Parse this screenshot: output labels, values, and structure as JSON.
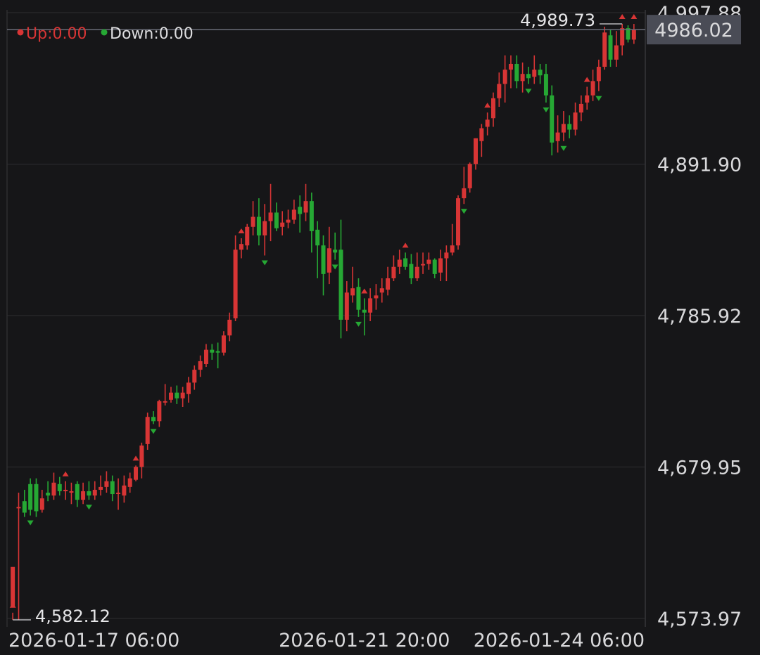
{
  "legend": {
    "up_label": "Up:0.00",
    "down_label": "Down:0.00",
    "up_color": "#d83535",
    "down_color": "#26a834"
  },
  "colors": {
    "background": "#161618",
    "grid": "#2e2e31",
    "axis_text": "#d8d8da",
    "price_tag_bg": "#4a4c56"
  },
  "chart_data": {
    "type": "candlestick",
    "ylim": [
      4573.97,
      4997.88
    ],
    "yticks": [
      "4,997.88",
      "4,891.90",
      "4,785.92",
      "4,679.95",
      "4,573.97"
    ],
    "ytick_values": [
      4997.88,
      4891.9,
      4785.92,
      4679.95,
      4573.97
    ],
    "xticks": [
      "2026-01-17 06:00",
      "2026-01-21 20:00",
      "2026-01-24 06:00"
    ],
    "xtick_positions": [
      15,
      60,
      92
    ],
    "last_price": "4986.02",
    "high_label": "4,989.73",
    "low_label": "4,582.12",
    "candles": [
      [
        4582,
        4610,
        4578,
        4573
      ],
      [
        4652,
        4652,
        4662,
        4573
      ],
      [
        4656,
        4648,
        4664,
        4645
      ],
      [
        4668,
        4650,
        4672,
        4646
      ],
      [
        4668,
        4649,
        4672,
        4645
      ],
      [
        4650,
        4658,
        4664,
        4648
      ],
      [
        4662,
        4660,
        4670,
        4656
      ],
      [
        4660,
        4669,
        4676,
        4657
      ],
      [
        4668,
        4663,
        4673,
        4660
      ],
      [
        4663,
        4664,
        4670,
        4657
      ],
      [
        4662,
        4663,
        4669,
        4654
      ],
      [
        4668,
        4657,
        4670,
        4652
      ],
      [
        4657,
        4663,
        4669,
        4654
      ],
      [
        4663,
        4660,
        4670,
        4657
      ],
      [
        4660,
        4664,
        4670,
        4657
      ],
      [
        4664,
        4666,
        4674,
        4660
      ],
      [
        4666,
        4670,
        4677,
        4662
      ],
      [
        4670,
        4661,
        4674,
        4656
      ],
      [
        4662,
        4662,
        4672,
        4650
      ],
      [
        4660,
        4667,
        4674,
        4655
      ],
      [
        4666,
        4672,
        4676,
        4662
      ],
      [
        4671,
        4680,
        4681,
        4670
      ],
      [
        4680,
        4695,
        4697,
        4672
      ],
      [
        4696,
        4715,
        4718,
        4692
      ],
      [
        4715,
        4712,
        4719,
        4710
      ],
      [
        4712,
        4726,
        4727,
        4708
      ],
      [
        4726,
        4726,
        4738,
        4723
      ],
      [
        4727,
        4732,
        4736,
        4725
      ],
      [
        4732,
        4728,
        4737,
        4724
      ],
      [
        4728,
        4732,
        4736,
        4722
      ],
      [
        4731,
        4739,
        4743,
        4725
      ],
      [
        4739,
        4748,
        4751,
        4734
      ],
      [
        4748,
        4754,
        4758,
        4743
      ],
      [
        4752,
        4762,
        4766,
        4750
      ],
      [
        4762,
        4760,
        4766,
        4755
      ],
      [
        4761,
        4760,
        4767,
        4749
      ],
      [
        4760,
        4772,
        4775,
        4758
      ],
      [
        4772,
        4783,
        4788,
        4768
      ],
      [
        4784,
        4832,
        4842,
        4782
      ],
      [
        4832,
        4836,
        4840,
        4826
      ],
      [
        4835,
        4848,
        4850,
        4832
      ],
      [
        4848,
        4855,
        4866,
        4842
      ],
      [
        4855,
        4842,
        4868,
        4835
      ],
      [
        4842,
        4852,
        4864,
        4828
      ],
      [
        4852,
        4858,
        4878,
        4838
      ],
      [
        4858,
        4847,
        4865,
        4845
      ],
      [
        4848,
        4851,
        4859,
        4842
      ],
      [
        4851,
        4853,
        4860,
        4847
      ],
      [
        4853,
        4860,
        4867,
        4850
      ],
      [
        4862,
        4857,
        4870,
        4844
      ],
      [
        4858,
        4866,
        4878,
        4852
      ],
      [
        4866,
        4845,
        4872,
        4830
      ],
      [
        4846,
        4835,
        4852,
        4812
      ],
      [
        4835,
        4815,
        4842,
        4800
      ],
      [
        4816,
        4833,
        4848,
        4808
      ],
      [
        4832,
        4830,
        4844,
        4825
      ],
      [
        4832,
        4783,
        4853,
        4770
      ],
      [
        4783,
        4802,
        4810,
        4775
      ],
      [
        4800,
        4805,
        4820,
        4795
      ],
      [
        4806,
        4790,
        4812,
        4785
      ],
      [
        4790,
        4788,
        4798,
        4772
      ],
      [
        4788,
        4798,
        4805,
        4782
      ],
      [
        4798,
        4800,
        4808,
        4790
      ],
      [
        4802,
        4805,
        4812,
        4795
      ],
      [
        4804,
        4812,
        4820,
        4800
      ],
      [
        4812,
        4820,
        4828,
        4810
      ],
      [
        4820,
        4825,
        4832,
        4815
      ],
      [
        4826,
        4820,
        4830,
        4818
      ],
      [
        4822,
        4812,
        4829,
        4808
      ],
      [
        4812,
        4820,
        4830,
        4810
      ],
      [
        4822,
        4822,
        4830,
        4815
      ],
      [
        4822,
        4825,
        4830,
        4818
      ],
      [
        4825,
        4815,
        4826,
        4812
      ],
      [
        4816,
        4826,
        4832,
        4810
      ],
      [
        4826,
        4830,
        4835,
        4810
      ],
      [
        4830,
        4835,
        4850,
        4828
      ],
      [
        4835,
        4868,
        4870,
        4832
      ],
      [
        4868,
        4875,
        4890,
        4864
      ],
      [
        4875,
        4892,
        4893,
        4872
      ],
      [
        4892,
        4910,
        4910,
        4888
      ],
      [
        4908,
        4917,
        4920,
        4897
      ],
      [
        4918,
        4923,
        4928,
        4912
      ],
      [
        4924,
        4938,
        4942,
        4918
      ],
      [
        4938,
        4948,
        4956,
        4932
      ],
      [
        4948,
        4958,
        4968,
        4935
      ],
      [
        4958,
        4962,
        4968,
        4945
      ],
      [
        4962,
        4950,
        4968,
        4945
      ],
      [
        4950,
        4955,
        4963,
        4942
      ],
      [
        4955,
        4952,
        4960,
        4948
      ],
      [
        4953,
        4958,
        4968,
        4948
      ],
      [
        4958,
        4954,
        4962,
        4948
      ],
      [
        4955,
        4940,
        4962,
        4935
      ],
      [
        4940,
        4907,
        4947,
        4898
      ],
      [
        4908,
        4914,
        4926,
        4900
      ],
      [
        4914,
        4920,
        4929,
        4908
      ],
      [
        4920,
        4916,
        4926,
        4910
      ],
      [
        4916,
        4928,
        4935,
        4912
      ],
      [
        4928,
        4934,
        4940,
        4922
      ],
      [
        4935,
        4940,
        4946,
        4930
      ],
      [
        4940,
        4950,
        4958,
        4936
      ],
      [
        4950,
        4960,
        4965,
        4943
      ],
      [
        4960,
        4984,
        4988,
        4958
      ],
      [
        4982,
        4965,
        4986,
        4960
      ],
      [
        4965,
        4975,
        4985,
        4960
      ],
      [
        4975,
        4987,
        4990,
        4968
      ],
      [
        4987,
        4979,
        4989,
        4977
      ],
      [
        4979,
        4986,
        4990,
        4976
      ]
    ],
    "up_markers": [
      0,
      9,
      21,
      39,
      60,
      67,
      81,
      98,
      104,
      106,
      108
    ],
    "down_markers": [
      3,
      13,
      24,
      43,
      55,
      59,
      77,
      88,
      91,
      94,
      100
    ]
  }
}
